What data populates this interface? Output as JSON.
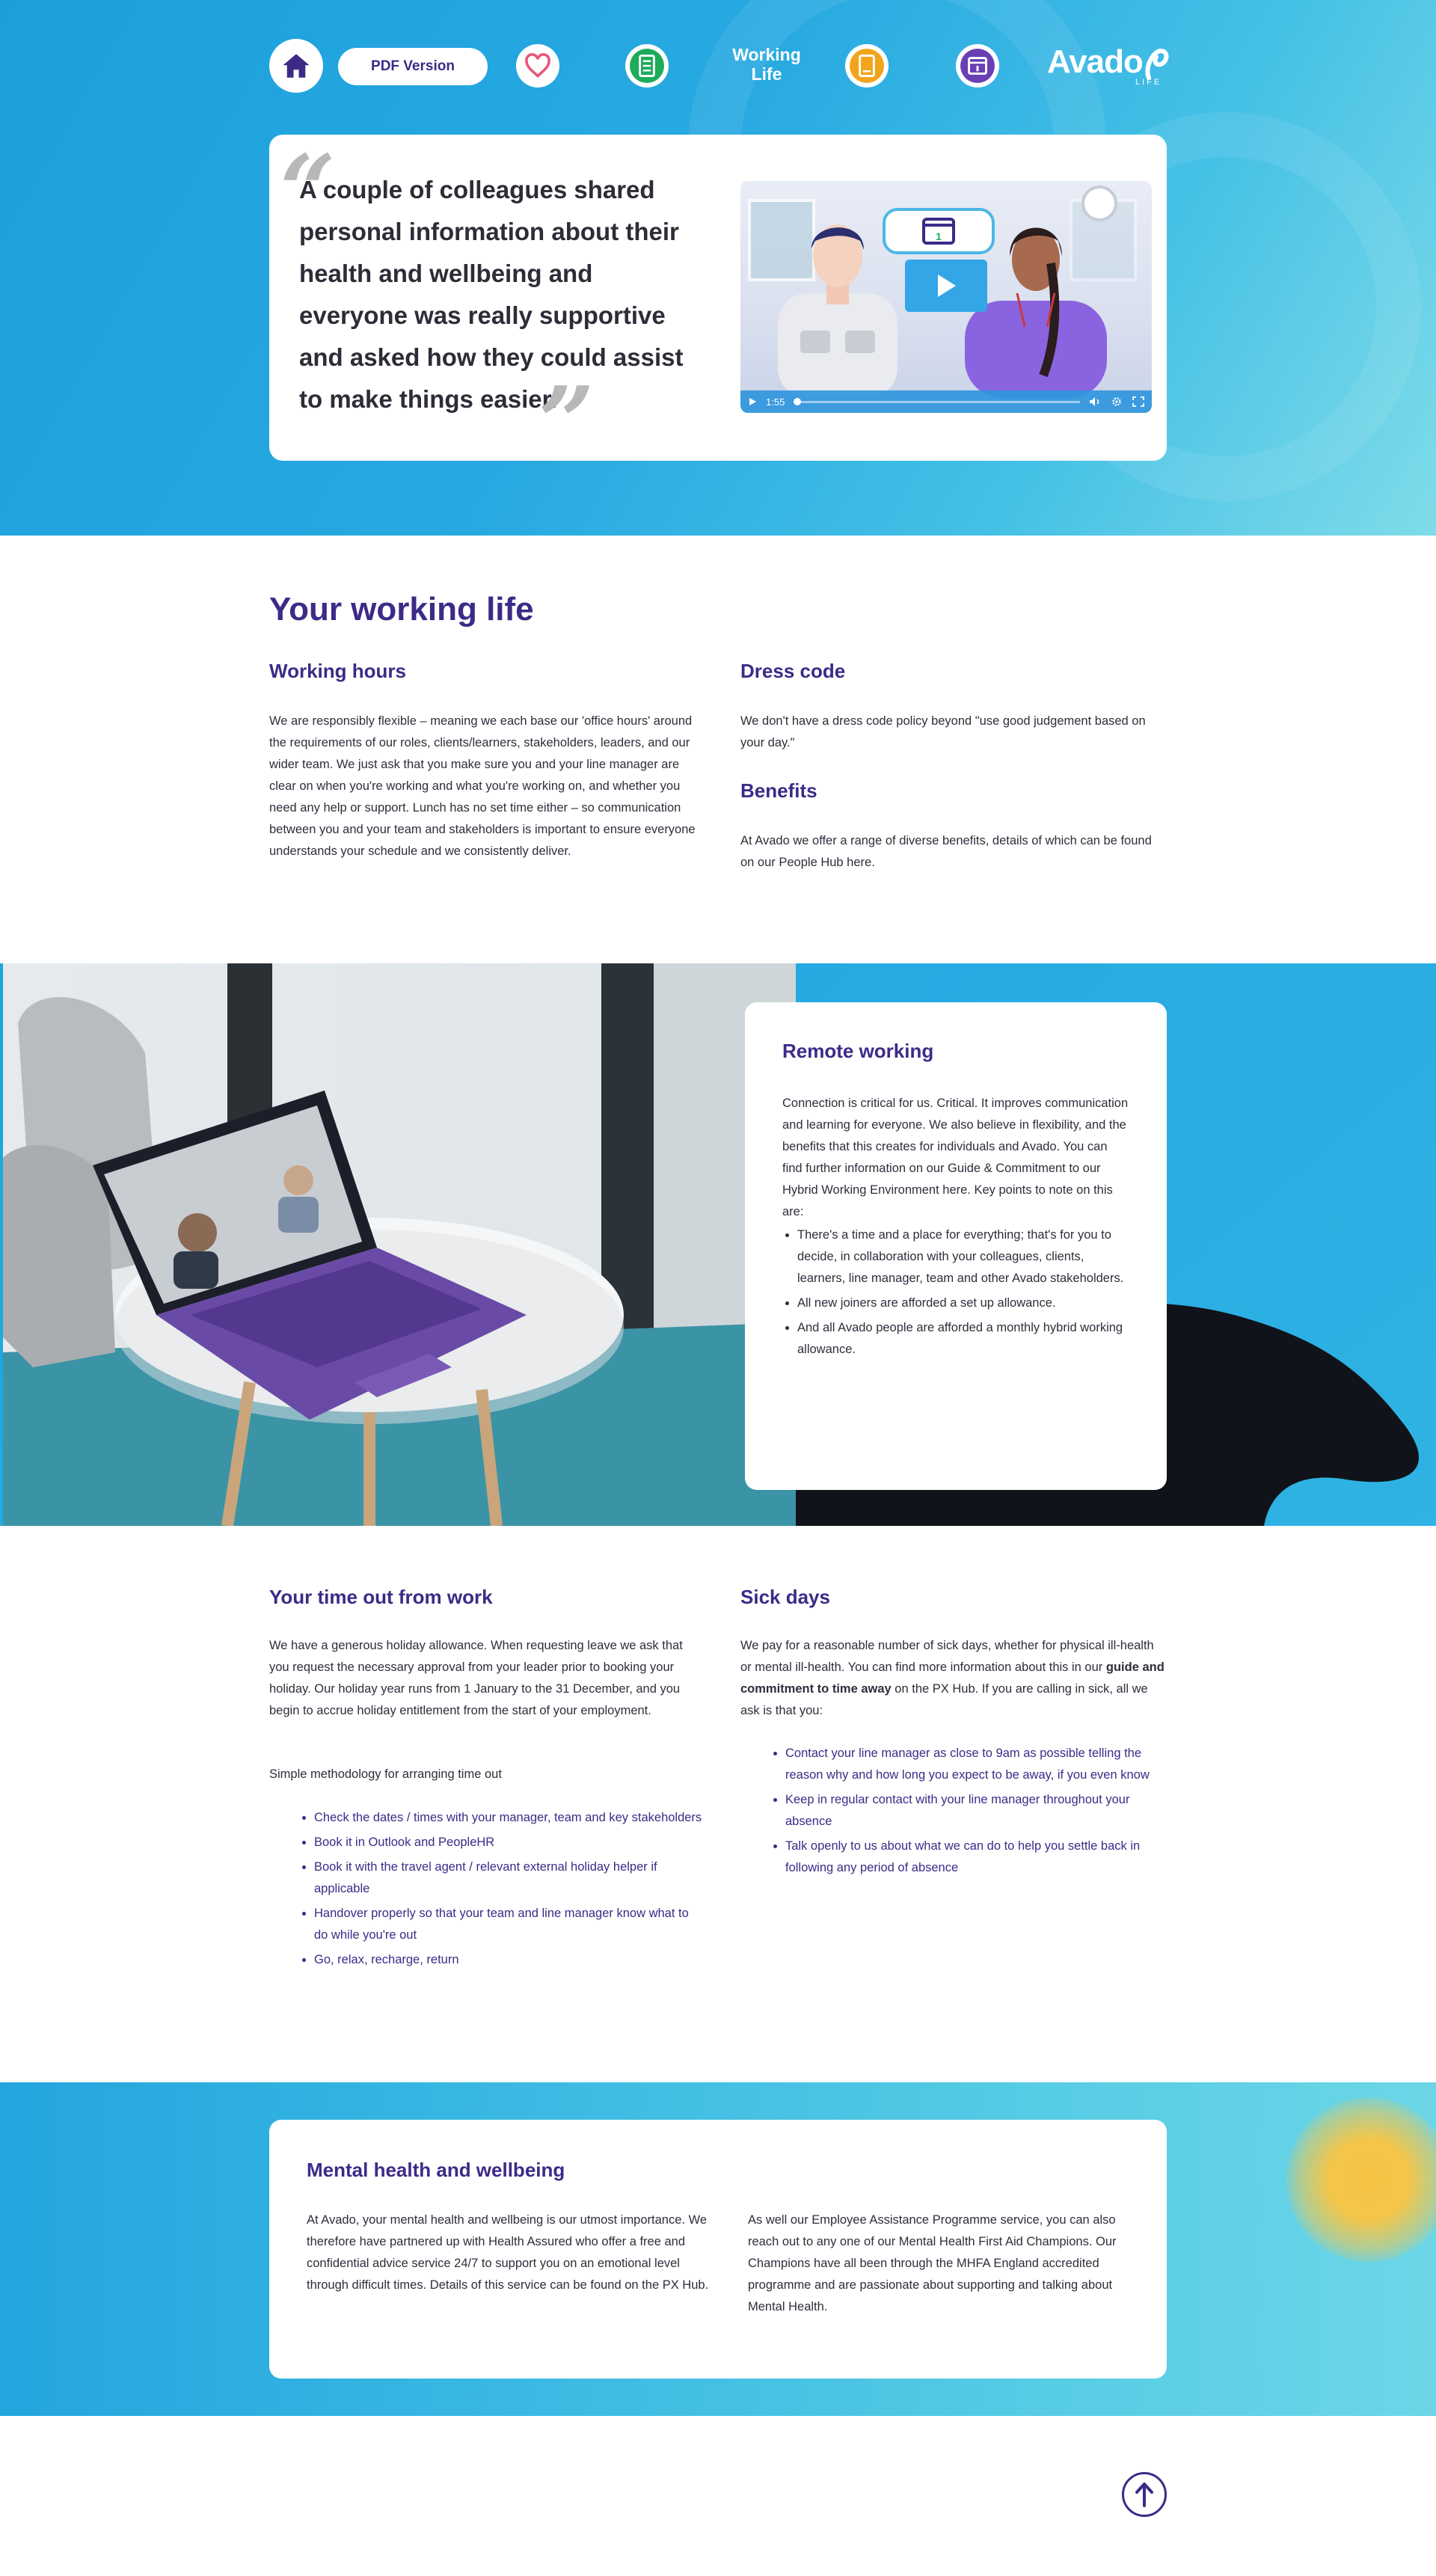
{
  "nav": {
    "pdf_label": "PDF Version",
    "section_label_1": "Working",
    "section_label_2": "Life",
    "logo_text": "Avado",
    "logo_sub": "LIFE",
    "icons": [
      "home-icon",
      "heart-icon",
      "document-icon",
      "book-icon",
      "calendar-icon"
    ],
    "colors": {
      "home": "#3d2a87",
      "heart": "#e8577a",
      "document": "#1eab5a",
      "book": "#f2a41b",
      "calendar": "#6a3fb3"
    }
  },
  "hero": {
    "quote": "A couple of colleagues shared personal information about their health and wellbeing and everyone was really supportive and asked how they could assist to make things easier.",
    "video": {
      "time": "1:55",
      "calendar_day": "1"
    }
  },
  "working_life": {
    "title": "Your working life",
    "hours_title": "Working hours",
    "hours_text": "We are responsibly flexible – meaning we each base our 'office hours' around the requirements of our roles, clients/learners, stakeholders, leaders, and our wider team. We just ask that you make sure you and your line manager are clear on when you're working and what you're working on, and whether you need any help or support. Lunch has no set time either – so communication between you and your team and stakeholders is important to ensure everyone understands your schedule and we consistently deliver.",
    "dress_title": "Dress code",
    "dress_text": "We don't have a dress code policy beyond \"use good judgement based on your day.\"",
    "benefits_title": "Benefits",
    "benefits_text": "At Avado we offer a range of diverse benefits, details of which can be found on our People Hub here."
  },
  "remote": {
    "title": "Remote working",
    "intro": "Connection is critical for us. Critical. It improves communication and learning for everyone. We also believe in flexibility, and the benefits that this creates for individuals and Avado. You can find further information on our Guide & Commitment to our Hybrid Working Environment here. Key points to note on this are:",
    "points": [
      "There's a time and a place for everything; that's for you to decide, in collaboration with your colleagues, clients, learners, line manager, team and other Avado stakeholders.",
      "All new joiners are afforded a set up allowance.",
      "And all Avado people are afforded a monthly hybrid working allowance."
    ]
  },
  "time_out": {
    "title": "Your time out from work",
    "text": "We have a generous holiday allowance. When requesting leave we ask that you request the necessary approval from your leader prior to booking your holiday. Our holiday year runs from 1 January to the 31 December, and you begin to accrue holiday entitlement from the start of your employment.",
    "sub": "Simple methodology for arranging time out",
    "steps": [
      "Check the dates / times with your manager, team and key stakeholders",
      "Book it in Outlook and PeopleHR",
      "Book it with the travel agent / relevant external holiday helper if applicable",
      "Handover properly so that your team and line manager know what to do while you're out",
      "Go, relax, recharge, return"
    ]
  },
  "sick": {
    "title": "Sick days",
    "text_1": "We pay for a reasonable number of sick days, whether for physical ill-health or mental ill-health. You can find more information about this in our ",
    "text_bold": "guide and commitment to time away",
    "text_2": " on the PX Hub. If you are calling in sick, all we ask is that you:",
    "steps": [
      "Contact your line manager as close to 9am as possible telling the reason why and how long you expect to be away, if you even know",
      "Keep in regular contact with your line manager throughout your absence",
      "Talk openly to us about what we can do to help you settle back in following any period of absence"
    ]
  },
  "mental_health": {
    "title": "Mental health and wellbeing",
    "col_1": "At Avado, your mental health and wellbeing is our utmost importance. We therefore have partnered up with Health Assured who offer a free and confidential advice service 24/7 to support you on an emotional level through difficult times. Details of this service can be found on the PX Hub.",
    "col_2": "As well our Employee Assistance Programme service, you can also reach out to any one of our Mental Health First Aid Champions. Our Champions have all been through the MHFA England accredited programme and are passionate about supporting and talking about Mental Health."
  },
  "back_to_top_icon": "arrow-up-icon"
}
